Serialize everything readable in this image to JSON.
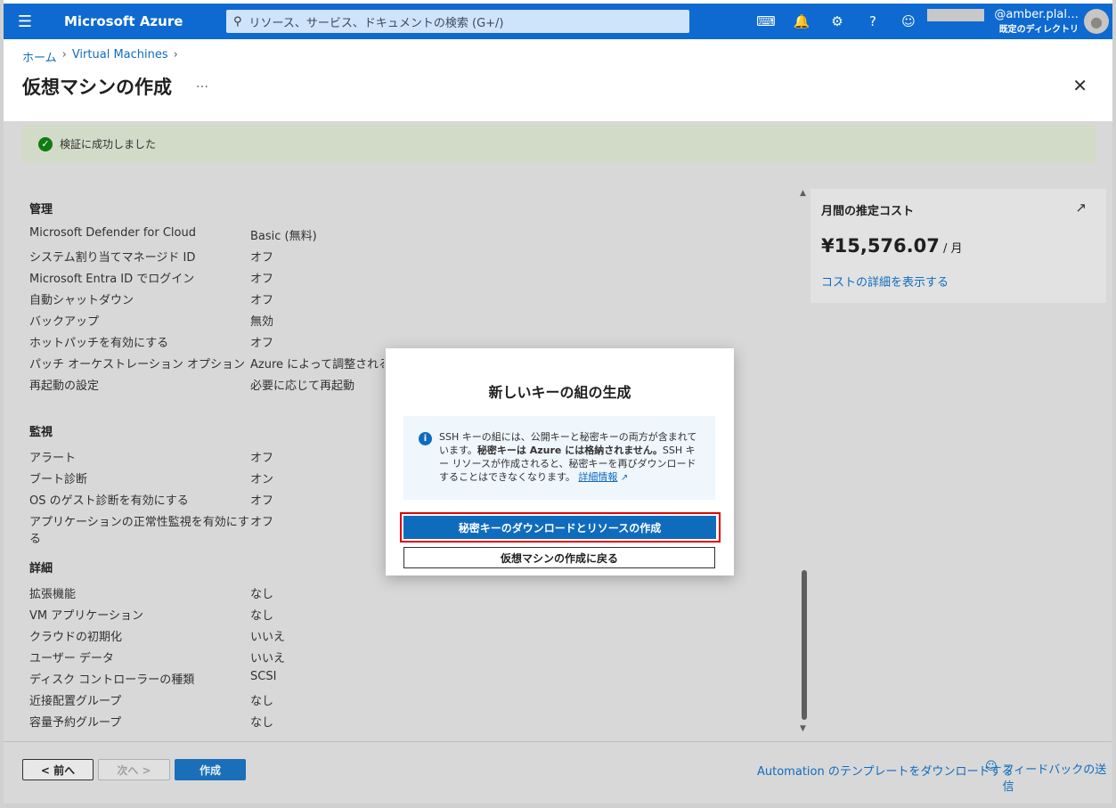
{
  "topbar": {
    "brand": "Microsoft Azure",
    "search_placeholder": "リソース、サービス、ドキュメントの検索 (G+/)",
    "icons": [
      "cloud-shell-icon",
      "bell-icon",
      "gear-icon",
      "help-icon",
      "feedback-icon"
    ],
    "user_email": "@amber.plal…",
    "user_directory": "既定のディレクトリ"
  },
  "breadcrumb": {
    "home": "ホーム",
    "vm": "Virtual Machines"
  },
  "page": {
    "title": "仮想マシンの作成",
    "ellipsis": "…"
  },
  "validation": {
    "text": "検証に成功しました"
  },
  "sections": {
    "management": {
      "title": "管理",
      "rows": [
        {
          "k": "Microsoft Defender for Cloud",
          "v": "Basic (無料)"
        },
        {
          "k": "システム割り当てマネージド ID",
          "v": "オフ"
        },
        {
          "k": "Microsoft Entra ID でログイン",
          "v": "オフ"
        },
        {
          "k": "自動シャットダウン",
          "v": "オフ"
        },
        {
          "k": "バックアップ",
          "v": "無効"
        },
        {
          "k": "ホットパッチを有効にする",
          "v": "オフ"
        },
        {
          "k": "パッチ オーケストレーション オプション",
          "v": "Azure によって調整されるパッチ"
        },
        {
          "k": "再起動の設定",
          "v": "必要に応じて再起動"
        }
      ]
    },
    "monitoring": {
      "title": "監視",
      "rows": [
        {
          "k": "アラート",
          "v": "オフ"
        },
        {
          "k": "ブート診断",
          "v": "オン"
        },
        {
          "k": "OS のゲスト診断を有効にする",
          "v": "オフ"
        },
        {
          "k": "アプリケーションの正常性監視を有効にする",
          "v": "オフ"
        }
      ]
    },
    "details": {
      "title": "詳細",
      "rows": [
        {
          "k": "拡張機能",
          "v": "なし"
        },
        {
          "k": "VM アプリケーション",
          "v": "なし"
        },
        {
          "k": "クラウドの初期化",
          "v": "いいえ"
        },
        {
          "k": "ユーザー データ",
          "v": "いいえ"
        },
        {
          "k": "ディスク コントローラーの種類",
          "v": "SCSI"
        },
        {
          "k": "近接配置グループ",
          "v": "なし"
        },
        {
          "k": "容量予約グループ",
          "v": "なし"
        }
      ]
    }
  },
  "cost": {
    "title": "月間の推定コスト",
    "value": "¥15,576.07",
    "unit": " / 月",
    "link": "コストの詳細を表示する"
  },
  "footer": {
    "prev": "< 前へ",
    "next": "次へ >",
    "create": "作成",
    "template_link": "Automation のテンプレートをダウンロードする",
    "feedback": "フィードバックの送信"
  },
  "modal": {
    "title": "新しいキーの組の生成",
    "info_part1": "SSH キーの組には、公開キーと秘密キーの両方が含まれています。",
    "info_bold": "秘密キーは Azure には格納されません。",
    "info_part2": "SSH キー リソースが作成されると、秘密キーを再びダウンロードすることはできなくなります。",
    "info_link": "詳細情報",
    "primary_button": "秘密キーのダウンロードとリソースの作成",
    "secondary_button": "仮想マシンの作成に戻る"
  }
}
